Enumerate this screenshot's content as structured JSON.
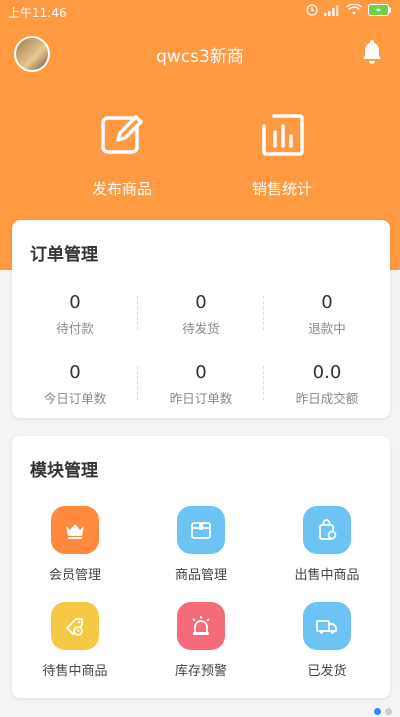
{
  "status_bar": {
    "time": "上午11:46"
  },
  "header": {
    "store_name": "qwcs3新商",
    "actions": [
      {
        "label": "发布商品",
        "icon": "edit-icon"
      },
      {
        "label": "销售统计",
        "icon": "bar-chart-icon"
      }
    ]
  },
  "orders": {
    "title": "订单管理",
    "stats": [
      {
        "value": "0",
        "label": "待付款"
      },
      {
        "value": "0",
        "label": "待发货"
      },
      {
        "value": "0",
        "label": "退款中"
      },
      {
        "value": "0",
        "label": "今日订单数"
      },
      {
        "value": "0",
        "label": "昨日订单数"
      },
      {
        "value": "0.0",
        "label": "昨日成交额"
      }
    ]
  },
  "modules": {
    "title": "模块管理",
    "items": [
      {
        "label": "会员管理",
        "icon": "crown-icon",
        "color": "#ff8a3d"
      },
      {
        "label": "商品管理",
        "icon": "box-icon",
        "color": "#6ec3f5"
      },
      {
        "label": "出售中商品",
        "icon": "shopping-bag-icon",
        "color": "#6ec3f5"
      },
      {
        "label": "待售中商品",
        "icon": "tag-clock-icon",
        "color": "#f5c945"
      },
      {
        "label": "库存预警",
        "icon": "alarm-icon",
        "color": "#f46c7a"
      },
      {
        "label": "已发货",
        "icon": "truck-icon",
        "color": "#6ec3f5"
      }
    ]
  },
  "colors": {
    "header": "#ff9a43",
    "page_indicator_active": "#2b8cf0"
  }
}
